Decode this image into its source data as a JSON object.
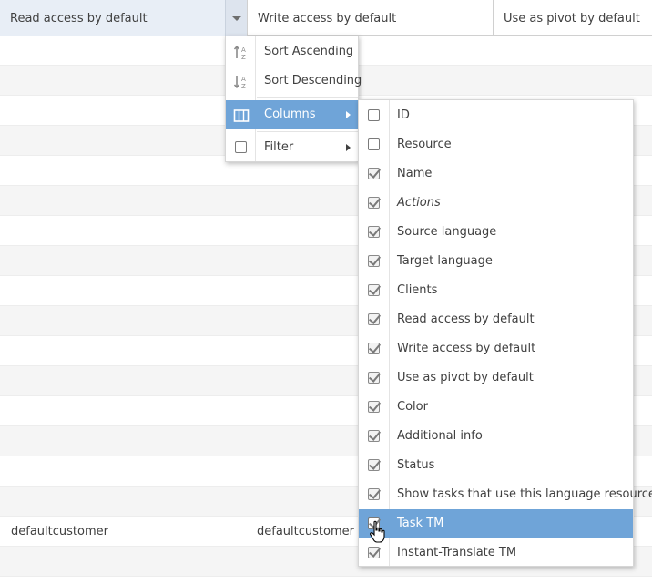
{
  "grid": {
    "columns": [
      {
        "label": "Read access by default"
      },
      {
        "label": "Write access by default"
      },
      {
        "label": "Use as pivot by default"
      }
    ],
    "rows": [
      {
        "read": "",
        "write": ""
      },
      {
        "read": "",
        "write": ""
      },
      {
        "read": "",
        "write": ""
      },
      {
        "read": "",
        "write": ""
      },
      {
        "read": "",
        "write": ""
      },
      {
        "read": "",
        "write": ""
      },
      {
        "read": "",
        "write": ""
      },
      {
        "read": "",
        "write": ""
      },
      {
        "read": "",
        "write": ""
      },
      {
        "read": "",
        "write": ""
      },
      {
        "read": "",
        "write": ""
      },
      {
        "read": "",
        "write": ""
      },
      {
        "read": "",
        "write": ""
      },
      {
        "read": "",
        "write": ""
      },
      {
        "read": "",
        "write": ""
      },
      {
        "read": "",
        "write": ""
      },
      {
        "read": "defaultcustomer",
        "write": "defaultcustomer"
      },
      {
        "read": "",
        "write": ""
      },
      {
        "read": "",
        "write": ""
      }
    ]
  },
  "header_menu": {
    "sort_ascending": "Sort Ascending",
    "sort_descending": "Sort Descending",
    "columns": "Columns",
    "filter": "Filter"
  },
  "columns_menu": {
    "items": [
      {
        "label": "ID",
        "checked": false
      },
      {
        "label": "Resource",
        "checked": false
      },
      {
        "label": "Name",
        "checked": true
      },
      {
        "label": "Actions",
        "checked": true
      },
      {
        "label": "Source language",
        "checked": true
      },
      {
        "label": "Target language",
        "checked": true
      },
      {
        "label": "Clients",
        "checked": true
      },
      {
        "label": "Read access by default",
        "checked": true
      },
      {
        "label": "Write access by default",
        "checked": true
      },
      {
        "label": "Use as pivot by default",
        "checked": true
      },
      {
        "label": "Color",
        "checked": true
      },
      {
        "label": "Additional info",
        "checked": true
      },
      {
        "label": "Status",
        "checked": true
      },
      {
        "label": "Show tasks that use this language resource",
        "checked": true
      },
      {
        "label": "Task TM",
        "checked": true
      },
      {
        "label": "Instant-Translate TM",
        "checked": true
      }
    ]
  },
  "colors": {
    "highlight": "#6fa4d8",
    "header_active": "#e8eef6",
    "row_alt": "#f5f5f5"
  }
}
